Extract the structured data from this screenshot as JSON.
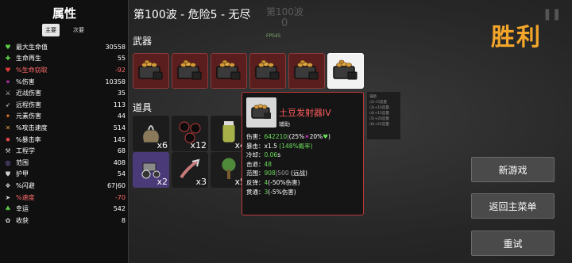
{
  "stats_panel": {
    "title": "属性",
    "tabs": [
      "主要",
      "次要"
    ],
    "stats": [
      {
        "icon": "heart-icon",
        "glyph": "♥",
        "color": "#5fd14a",
        "label": "最大生命值",
        "value": "30558",
        "label_color": "#ffffff",
        "value_color": "#ffffff"
      },
      {
        "icon": "plus-heart-icon",
        "glyph": "✚",
        "color": "#5fd14a",
        "label": "生命再生",
        "value": "55",
        "label_color": "#ffffff",
        "value_color": "#ffffff"
      },
      {
        "icon": "drop-icon",
        "glyph": "♥",
        "color": "#e23b3b",
        "label": "%生命窃取",
        "value": "-92",
        "label_color": "#ff6a6a",
        "value_color": "#ff6a6a"
      },
      {
        "icon": "damage-icon",
        "glyph": "✶",
        "color": "#e23bd0",
        "label": "%伤害",
        "value": "10358",
        "label_color": "#ffffff",
        "value_color": "#ffffff"
      },
      {
        "icon": "sword-icon",
        "glyph": "⚔",
        "color": "#cfcfcf",
        "label": "近战伤害",
        "value": "35",
        "label_color": "#ffffff",
        "value_color": "#ffffff"
      },
      {
        "icon": "bow-icon",
        "glyph": "➶",
        "color": "#cfcfcf",
        "label": "远程伤害",
        "value": "113",
        "label_color": "#ffffff",
        "value_color": "#ffffff"
      },
      {
        "icon": "element-icon",
        "glyph": "✦",
        "color": "#f07a2a",
        "label": "元素伤害",
        "value": "44",
        "label_color": "#ffffff",
        "value_color": "#ffffff"
      },
      {
        "icon": "attack-speed-icon",
        "glyph": "✕",
        "color": "#e8a23a",
        "label": "%攻击速度",
        "value": "514",
        "label_color": "#ffffff",
        "value_color": "#ffffff"
      },
      {
        "icon": "crit-icon",
        "glyph": "✸",
        "color": "#e84a4a",
        "label": "%暴击率",
        "value": "145",
        "label_color": "#ffffff",
        "value_color": "#ffffff"
      },
      {
        "icon": "wrench-icon",
        "glyph": "⚒",
        "color": "#d0d0d0",
        "label": "工程学",
        "value": "68",
        "label_color": "#ffffff",
        "value_color": "#ffffff"
      },
      {
        "icon": "range-icon",
        "glyph": "◎",
        "color": "#9a7ae0",
        "label": "范围",
        "value": "408",
        "label_color": "#ffffff",
        "value_color": "#ffffff"
      },
      {
        "icon": "armor-icon",
        "glyph": "⛊",
        "color": "#d0d0d0",
        "label": "护甲",
        "value": "54",
        "label_color": "#ffffff",
        "value_color": "#ffffff"
      },
      {
        "icon": "dodge-icon",
        "glyph": "❖",
        "color": "#d0d0d0",
        "label": "%闪避",
        "value": "67|60",
        "label_color": "#ffffff",
        "value_color": "#ffffff"
      },
      {
        "icon": "speed-icon",
        "glyph": "➤",
        "color": "#d0d0d0",
        "label": "%速度",
        "value": "-70",
        "label_color": "#ff6a6a",
        "value_color": "#ff6a6a"
      },
      {
        "icon": "luck-icon",
        "glyph": "♣",
        "color": "#5fd14a",
        "label": "幸运",
        "value": "542",
        "label_color": "#ffffff",
        "value_color": "#ffffff"
      },
      {
        "icon": "harvest-icon",
        "glyph": "✿",
        "color": "#d0d0d0",
        "label": "收获",
        "value": "8",
        "label_color": "#ffffff",
        "value_color": "#ffffff"
      }
    ]
  },
  "header": {
    "wave_title": "第100波 - 危险5 - 无尽",
    "ghost_wave": "第100波",
    "ghost_count": "0",
    "fps": "FPS45",
    "victory": "胜利"
  },
  "weapons": {
    "label": "武器",
    "slots": [
      {
        "name": "potato-launcher-icon",
        "selected": false
      },
      {
        "name": "potato-launcher-icon",
        "selected": false
      },
      {
        "name": "potato-launcher-icon",
        "selected": false
      },
      {
        "name": "potato-launcher-icon",
        "selected": false
      },
      {
        "name": "potato-launcher-icon",
        "selected": false
      },
      {
        "name": "potato-launcher-icon",
        "selected": true
      }
    ]
  },
  "items": {
    "label": "道具",
    "slots": [
      {
        "icon": "sack-icon",
        "count": "x6"
      },
      {
        "icon": "dark-orbs-icon",
        "count": "x12"
      },
      {
        "icon": "jar-icon",
        "count": "x4"
      },
      {
        "icon": "tractor-icon",
        "count": "x2"
      },
      {
        "icon": "claw-icon",
        "count": "x3"
      },
      {
        "icon": "tree-icon",
        "count": "x5"
      }
    ]
  },
  "tooltip": {
    "name": "土豆发射器IV",
    "tag": "辅助",
    "rows": {
      "damage_label": "伤害：",
      "damage_value": "642210",
      "damage_sep": "|",
      "damage_p1": "(25%",
      "damage_p2": "20%",
      "damage_close": ")",
      "crit_label": "暴击：",
      "crit_value": "x1.5",
      "crit_chance": "(148%概率)",
      "cooldown_label": "冷却：",
      "cooldown_value": "0.06",
      "cooldown_unit": "s",
      "knockback_label": "击退：",
      "knockback_value": "48",
      "range_label": "范围：",
      "range_value": "908",
      "range_sep": "|500",
      "range_note": " (远战)",
      "bounce_label": "反弹：",
      "bounce_value": "4",
      "bounce_note": "(-50%伤害)",
      "pierce_label": "贯通：",
      "pierce_value": "3",
      "pierce_note": "(-5%伤害)"
    }
  },
  "side_info": {
    "lines": [
      "辅助",
      "(2)+5造量",
      "(3)+10造量",
      "(4)+15造量",
      "(5)+20造量",
      "(6)+25造量"
    ]
  },
  "buttons": {
    "new_game": "新游戏",
    "main_menu": "返回主菜单",
    "retry": "重试"
  }
}
